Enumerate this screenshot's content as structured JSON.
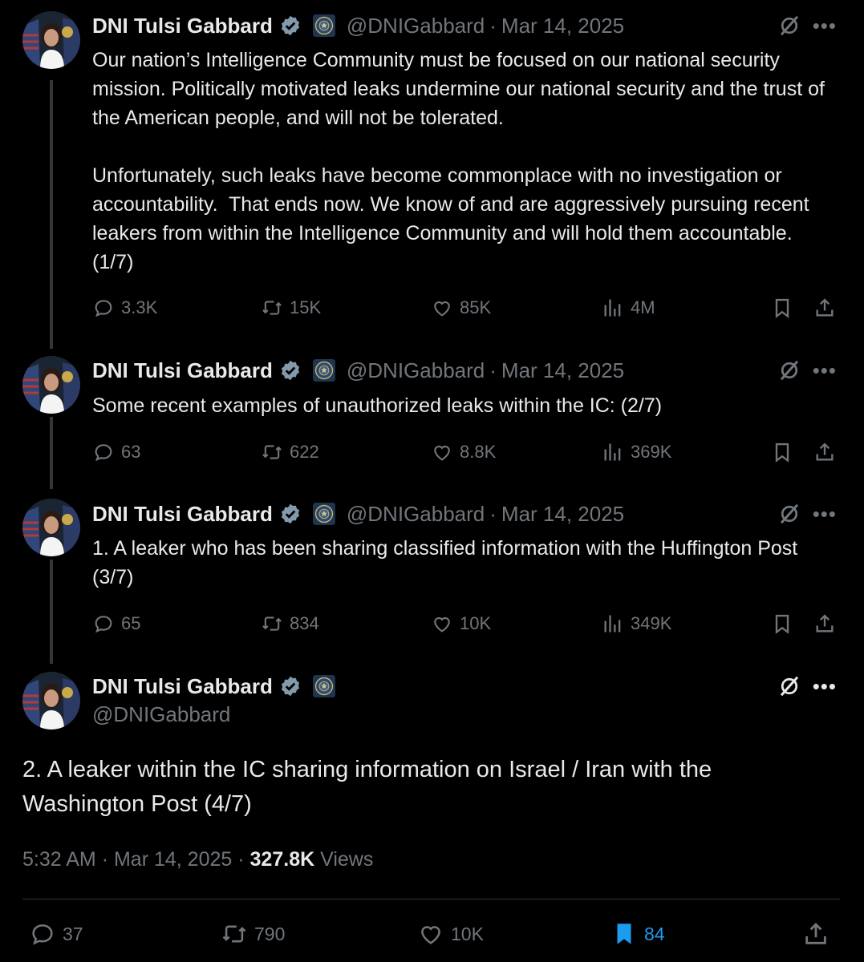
{
  "author": {
    "name": "DNI Tulsi Gabbard",
    "handle": "@DNIGabbard",
    "date": "Mar 14, 2025",
    "separator": "·"
  },
  "icons": {
    "verified": "verified-badge-icon",
    "seal": "dni-seal-icon",
    "grok": "grok-icon",
    "more": "more-icon",
    "reply": "reply-icon",
    "retweet": "retweet-icon",
    "like": "like-icon",
    "views": "views-icon",
    "bookmark": "bookmark-icon",
    "share": "share-icon"
  },
  "colors": {
    "background": "#000000",
    "text": "#e7e9ea",
    "muted": "#71767b",
    "accent": "#1d9bf0"
  },
  "more_label": "•••",
  "tweets": [
    {
      "text": "Our nation’s Intelligence Community must be focused on our national security mission. Politically motivated leaks undermine our national security and the trust of the American people, and will not be tolerated.\n\nUnfortunately, such leaks have become commonplace with no investigation or accountability.  That ends now. We know of and are aggressively pursuing recent leakers from within the Intelligence Community and will hold them accountable.  (1/7)",
      "replies": "3.3K",
      "reposts": "15K",
      "likes": "85K",
      "views": "4M"
    },
    {
      "text": "Some recent examples of unauthorized leaks within the IC: (2/7)",
      "replies": "63",
      "reposts": "622",
      "likes": "8.8K",
      "views": "369K"
    },
    {
      "text": "1. A leaker who has been sharing classified information with the Huffington Post (3/7)",
      "replies": "65",
      "reposts": "834",
      "likes": "10K",
      "views": "349K"
    }
  ],
  "main_tweet": {
    "text": "2. A leaker within the IC sharing information on Israel / Iran with the Washington Post (4/7)",
    "time": "5:32 AM",
    "date": "Mar 14, 2025",
    "views_count": "327.8K",
    "views_label": "Views",
    "replies": "37",
    "reposts": "790",
    "likes": "10K",
    "bookmarks": "84"
  }
}
